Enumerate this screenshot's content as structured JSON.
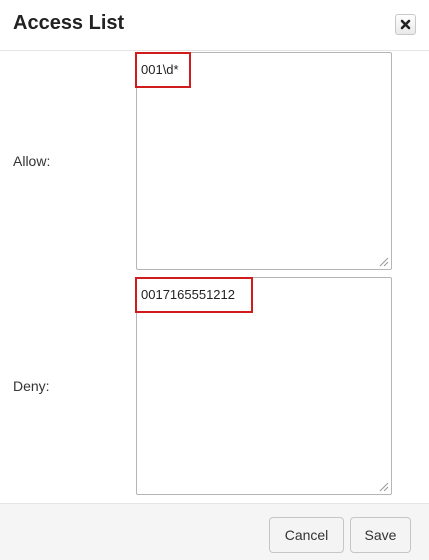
{
  "dialog": {
    "title": "Access List",
    "close_icon": "close-x-icon"
  },
  "allow": {
    "label": "Allow:",
    "value": "001\\d*"
  },
  "deny": {
    "label": "Deny:",
    "value": "0017165551212"
  },
  "footer": {
    "cancel_label": "Cancel",
    "save_label": "Save"
  },
  "colors": {
    "highlight": "#d01c1c",
    "footer_bg": "#f5f5f5"
  }
}
